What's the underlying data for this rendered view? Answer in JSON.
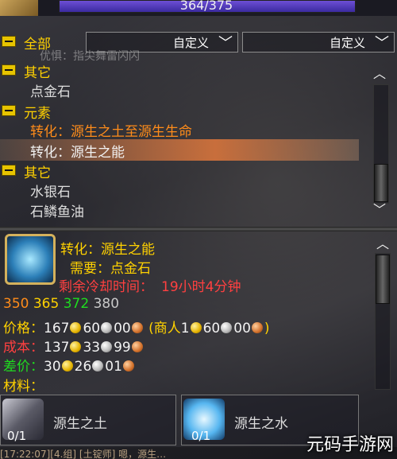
{
  "top": {
    "xp_text": "364/375"
  },
  "filters": [
    {
      "label": "自定义"
    },
    {
      "label": "自定义"
    }
  ],
  "list": {
    "faint_text": "优惧：指尖舞雷闪闪",
    "rows": [
      {
        "type": "header",
        "label": "全部"
      },
      {
        "type": "header",
        "label": "其它"
      },
      {
        "type": "item",
        "label": "点金石"
      },
      {
        "type": "header",
        "label": "元素"
      },
      {
        "type": "item",
        "label": "转化：源生之土至源生生命",
        "color": "orange"
      },
      {
        "type": "item",
        "label": "转化：源生之能",
        "selected": true
      },
      {
        "type": "header",
        "label": "其它"
      },
      {
        "type": "item",
        "label": "水银石"
      },
      {
        "type": "item",
        "label": "石鳞鱼油"
      }
    ]
  },
  "detail": {
    "icon": "arcane-energy-icon",
    "name": "转化：源生之能",
    "requires": "需要：点金石",
    "cooldown_label": "剩余冷却时间：",
    "cooldown_value": "19小时4分钟",
    "skill_levels": [
      "350",
      "365",
      "372",
      "380"
    ],
    "price_label": "价格：",
    "price": {
      "gold": "167",
      "silver": "60",
      "copper": "00"
    },
    "vendor_label": "(商人",
    "vendor": {
      "gold": "1",
      "silver": "60",
      "copper": "00"
    },
    "cost_label": "成本：",
    "cost": {
      "gold": "137",
      "silver": "33",
      "copper": "99"
    },
    "diff_label": "差价：",
    "diff": {
      "gold": "30",
      "silver": "26",
      "copper": "01"
    },
    "materials_label": "材料："
  },
  "materials": [
    {
      "name": "源生之土",
      "count": "0/1",
      "icon": "earth-crystal-icon"
    },
    {
      "name": "源生之水",
      "count": "0/1",
      "icon": "water-globe-icon"
    }
  ],
  "chat_text": "[17:22:07][4.组] [土锭师] 嗯，源生…",
  "watermark": "元码手游网",
  "colors": {
    "header": "#ffd100",
    "orange": "#ff8c1a",
    "cooldown": "#ff4040",
    "green": "#1fdc1f"
  }
}
